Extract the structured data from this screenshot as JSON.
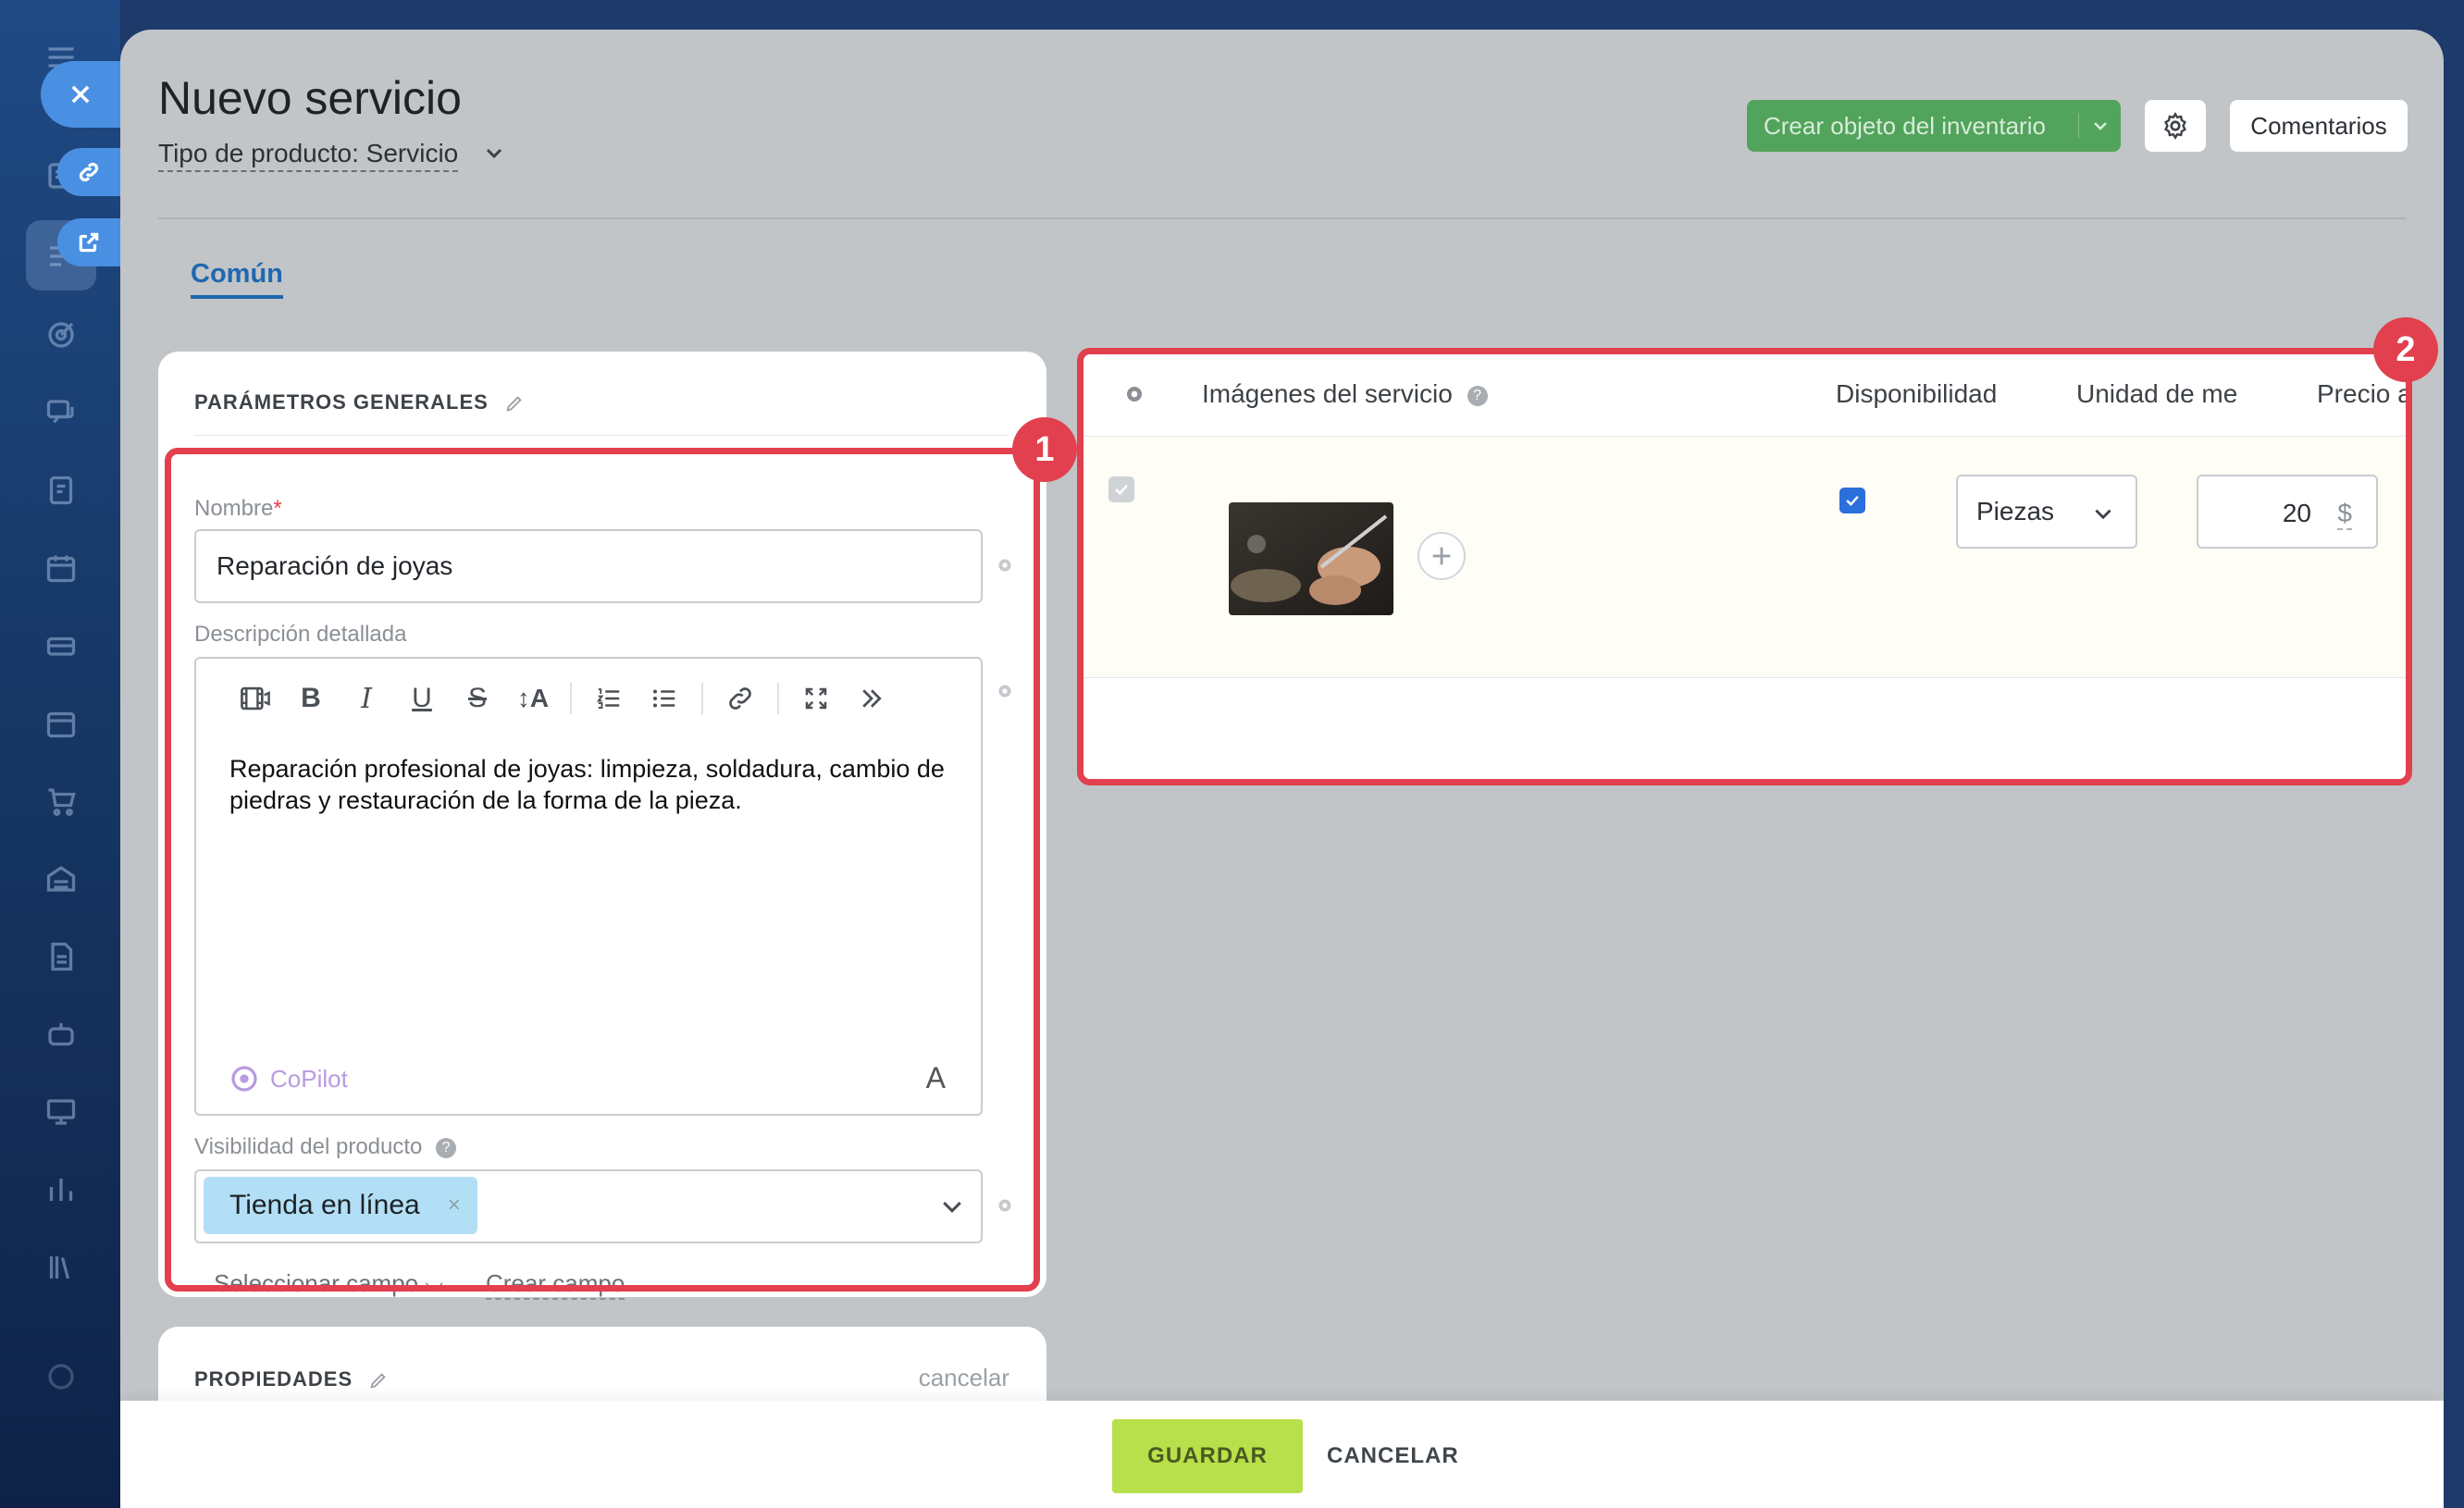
{
  "header": {
    "title": "Nuevo servicio",
    "product_type": "Tipo de producto: Servicio",
    "create_inventory_label": "Crear objeto del inventario",
    "comments_label": "Comentarios"
  },
  "tabs": [
    {
      "label": "Común",
      "active": true
    }
  ],
  "general_params": {
    "title": "PARÁMETROS GENERALES",
    "name_label": "Nombre",
    "name_required_mark": "*",
    "name_value": "Reparación de joyas",
    "description_label": "Descripción detallada",
    "description_text": "Reparación profesional de joyas: limpieza, soldadura, cambio de piedras y restauración de la forma de la pieza.",
    "copilot_label": "CoPilot",
    "font_button": "A",
    "visibility_label": "Visibilidad del producto",
    "visibility_chip": "Tienda en línea",
    "chip_remove": "×",
    "select_field_label": "Seleccionar campo",
    "create_field_label": "Crear campo"
  },
  "properties": {
    "title": "PROPIEDADES",
    "cancel_label": "cancelar"
  },
  "grid": {
    "columns": [
      "Imágenes del servicio",
      "Disponibilidad",
      "Unidad de me",
      "Precio al por r"
    ],
    "row": {
      "available": true,
      "unit": "Piezas",
      "price": "20",
      "currency": "$"
    }
  },
  "annotations": [
    "1",
    "2"
  ],
  "footer": {
    "save_label": "GUARDAR",
    "cancel_label": "CANCELAR"
  },
  "colors": {
    "accent_blue": "#2067b0",
    "primary_green": "#52a35c",
    "save_lime": "#b8e04a",
    "annotation_red": "#e2404e",
    "chip_blue": "#b3dff6"
  }
}
